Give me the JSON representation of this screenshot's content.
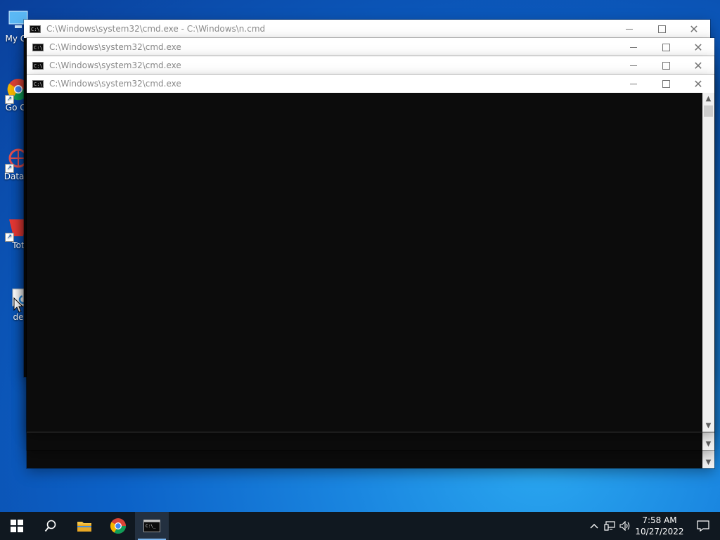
{
  "desktop": {
    "icons": [
      {
        "label": "My Co"
      },
      {
        "label": "Go Ch"
      },
      {
        "label": "DataW"
      },
      {
        "label": "Tot"
      },
      {
        "label": "de"
      }
    ]
  },
  "windows": [
    {
      "title": "C:\\Windows\\system32\\cmd.exe - C:\\Windows\\n.cmd"
    },
    {
      "title": "C:\\Windows\\system32\\cmd.exe"
    },
    {
      "title": "C:\\Windows\\system32\\cmd.exe"
    },
    {
      "title": "C:\\Windows\\system32\\cmd.exe"
    }
  ],
  "taskbar": {
    "items": [
      "start-icon",
      "search-icon",
      "file-explorer-icon",
      "chrome-icon",
      "cmd-icon"
    ],
    "tray": {
      "time": "7:58 AM",
      "date": "10/27/2022"
    }
  }
}
